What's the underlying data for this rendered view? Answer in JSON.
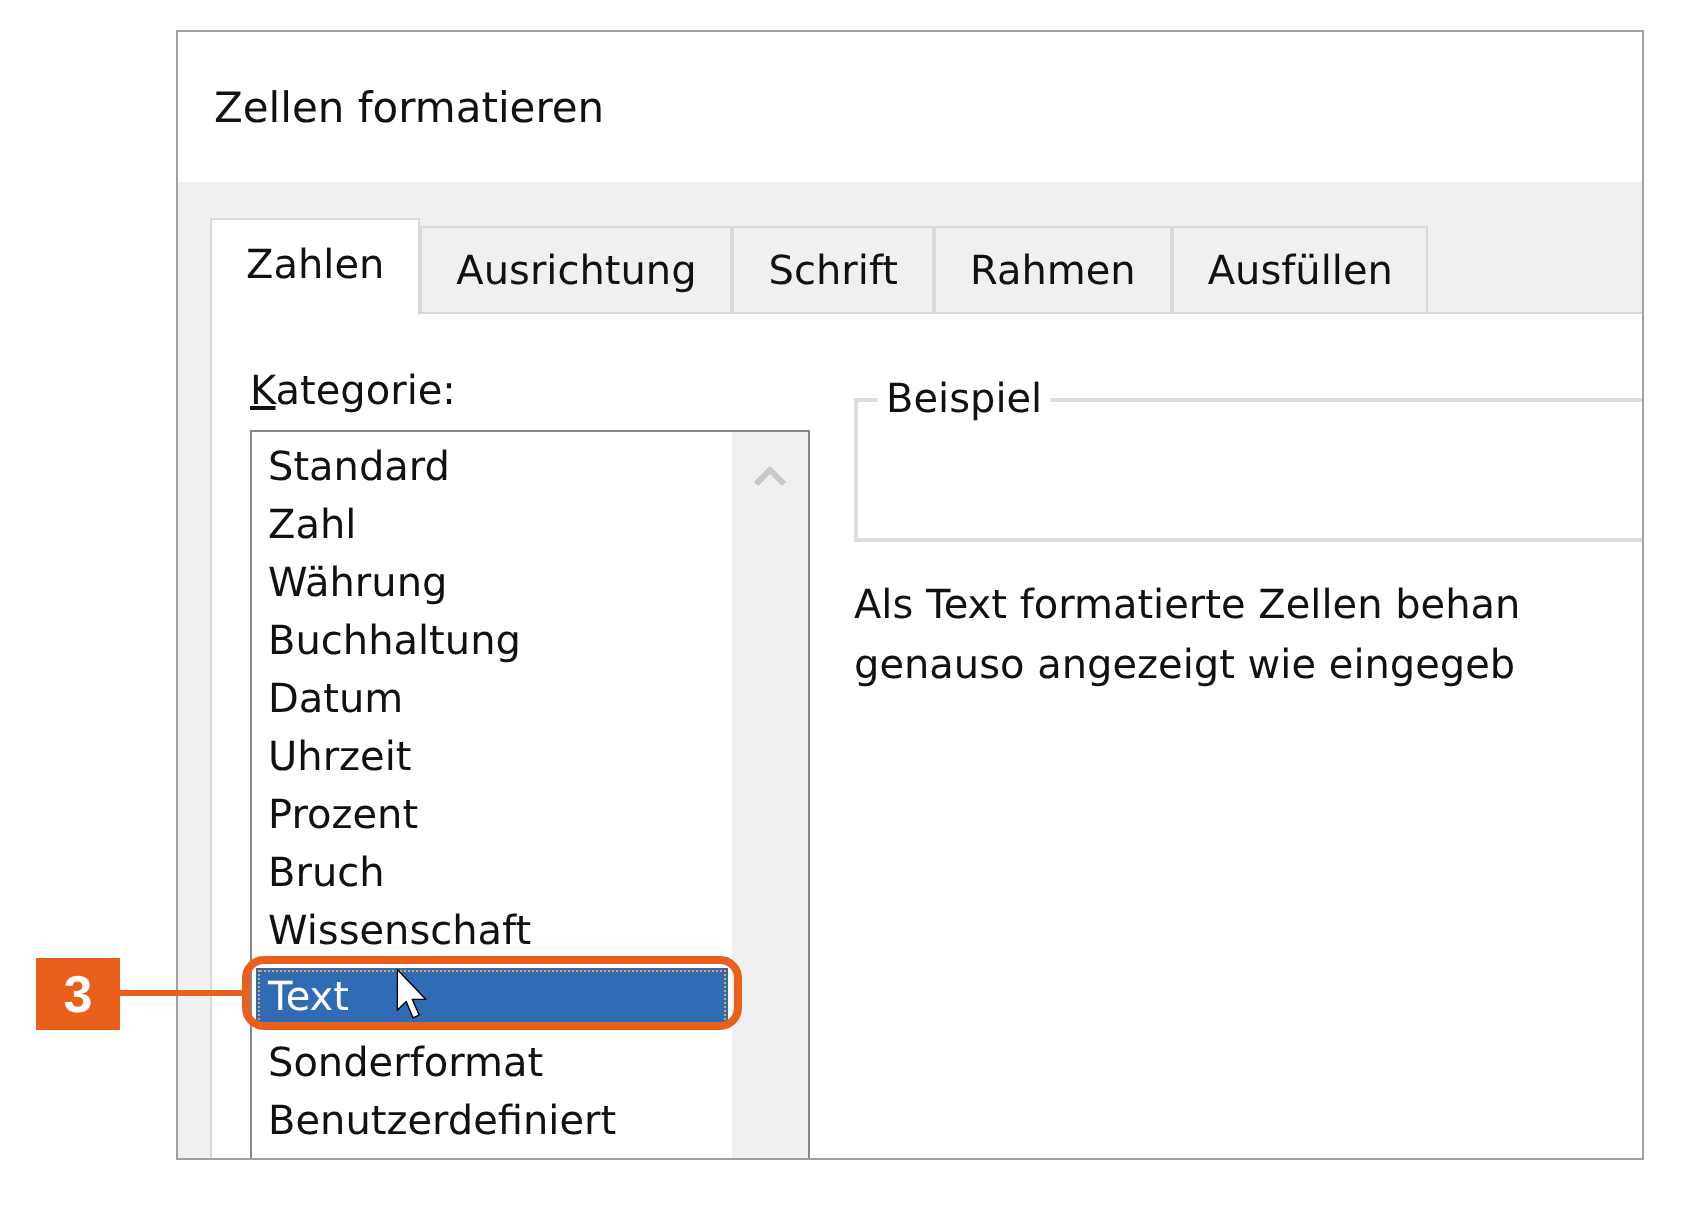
{
  "window": {
    "title": "Zellen formatieren"
  },
  "tabs": [
    {
      "label": "Zahlen",
      "selected": true
    },
    {
      "label": "Ausrichtung",
      "selected": false
    },
    {
      "label": "Schrift",
      "selected": false
    },
    {
      "label": "Rahmen",
      "selected": false
    },
    {
      "label": "Ausfüllen",
      "selected": false
    }
  ],
  "category": {
    "label": "Kategorie:",
    "items": [
      {
        "label": "Standard",
        "selected": false
      },
      {
        "label": "Zahl",
        "selected": false
      },
      {
        "label": "Währung",
        "selected": false
      },
      {
        "label": "Buchhaltung",
        "selected": false
      },
      {
        "label": "Datum",
        "selected": false
      },
      {
        "label": "Uhrzeit",
        "selected": false
      },
      {
        "label": "Prozent",
        "selected": false
      },
      {
        "label": "Bruch",
        "selected": false
      },
      {
        "label": "Wissenschaft",
        "selected": false
      },
      {
        "label": "Text",
        "selected": true
      },
      {
        "label": "Sonderformat",
        "selected": false
      },
      {
        "label": "Benutzerdefiniert",
        "selected": false
      }
    ]
  },
  "sample": {
    "label": "Beispiel"
  },
  "description": [
    "Als Text formatierte Zellen behan",
    "genauso angezeigt wie eingegeb"
  ],
  "callout": {
    "number": "3"
  }
}
